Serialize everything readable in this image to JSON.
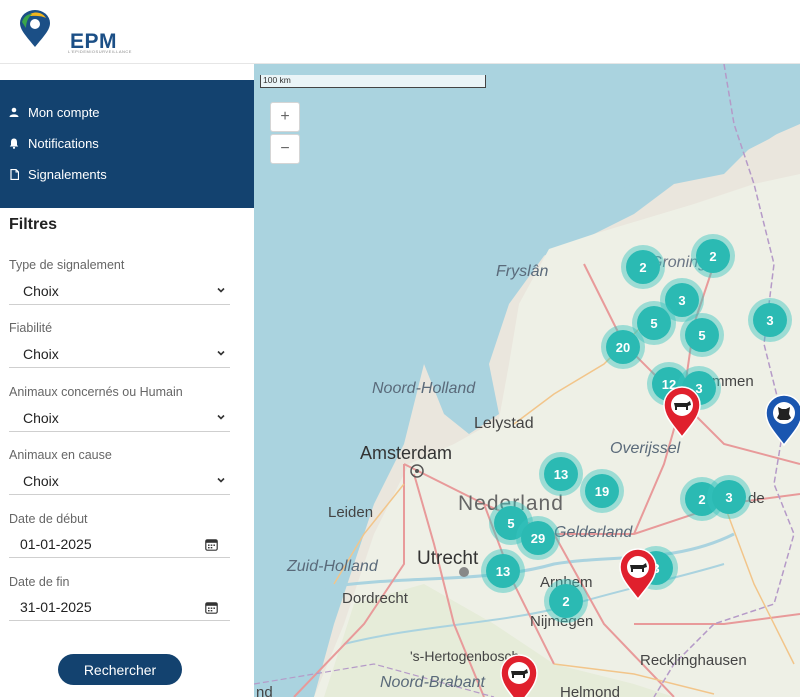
{
  "header": {
    "logo_text": "EPM",
    "logo_tagline": "L'EPIDEMIOSURVEILLANCE"
  },
  "nav": {
    "items": [
      {
        "label": "Mon compte",
        "icon": "user-icon"
      },
      {
        "label": "Notifications",
        "icon": "bell-icon"
      },
      {
        "label": "Signalements",
        "icon": "document-icon"
      }
    ]
  },
  "filters": {
    "title": "Filtres",
    "type": {
      "label": "Type de signalement",
      "value": "Choix"
    },
    "fiabilite": {
      "label": "Fiabilité",
      "value": "Choix"
    },
    "animaux_concernes": {
      "label": "Animaux concernés ou Humain",
      "value": "Choix"
    },
    "animaux_cause": {
      "label": "Animaux en cause",
      "value": "Choix"
    },
    "date_debut": {
      "label": "Date de début",
      "value": "01-01-2025"
    },
    "date_fin": {
      "label": "Date de fin",
      "value": "31-01-2025"
    },
    "search_label": "Rechercher"
  },
  "map": {
    "scale_label": "100 km",
    "zoom_in": "+",
    "zoom_out": "−",
    "places": {
      "fryslan": "Fryslân",
      "groningen": "Groningen",
      "noord_holland": "Noord-Holland",
      "lelystad": "Lelystad",
      "amsterdam": "Amsterdam",
      "leiden": "Leiden",
      "nederland": "Nederland",
      "gelderland": "Gelderland",
      "overijssel": "Overijssel",
      "emmen": "mmen",
      "zuid_holland": "Zuid-Holland",
      "utrecht": "Utrecht",
      "dordrecht": "Dordrecht",
      "arnhem": "Arnhem",
      "nijmegen": "Nijmegen",
      "hertogenbosch": "'s-Hertogenbosch",
      "noord_brabant": "Noord-Brabant",
      "helmond": "Helmond",
      "recklinghausen": "Recklinghausen",
      "de": "de",
      "nd": "nd"
    },
    "clusters": [
      "2",
      "2",
      "3",
      "5",
      "5",
      "20",
      "3",
      "12",
      "3",
      "13",
      "19",
      "2",
      "3",
      "5",
      "29",
      "13",
      "2",
      "3"
    ],
    "pins": [
      {
        "color": "#e0202d",
        "icon": "cow-icon"
      },
      {
        "color": "#e0202d",
        "icon": "cow-icon"
      },
      {
        "color": "#e0202d",
        "icon": "cow-icon"
      },
      {
        "color": "#1a56b0",
        "icon": "dog-icon"
      }
    ]
  }
}
